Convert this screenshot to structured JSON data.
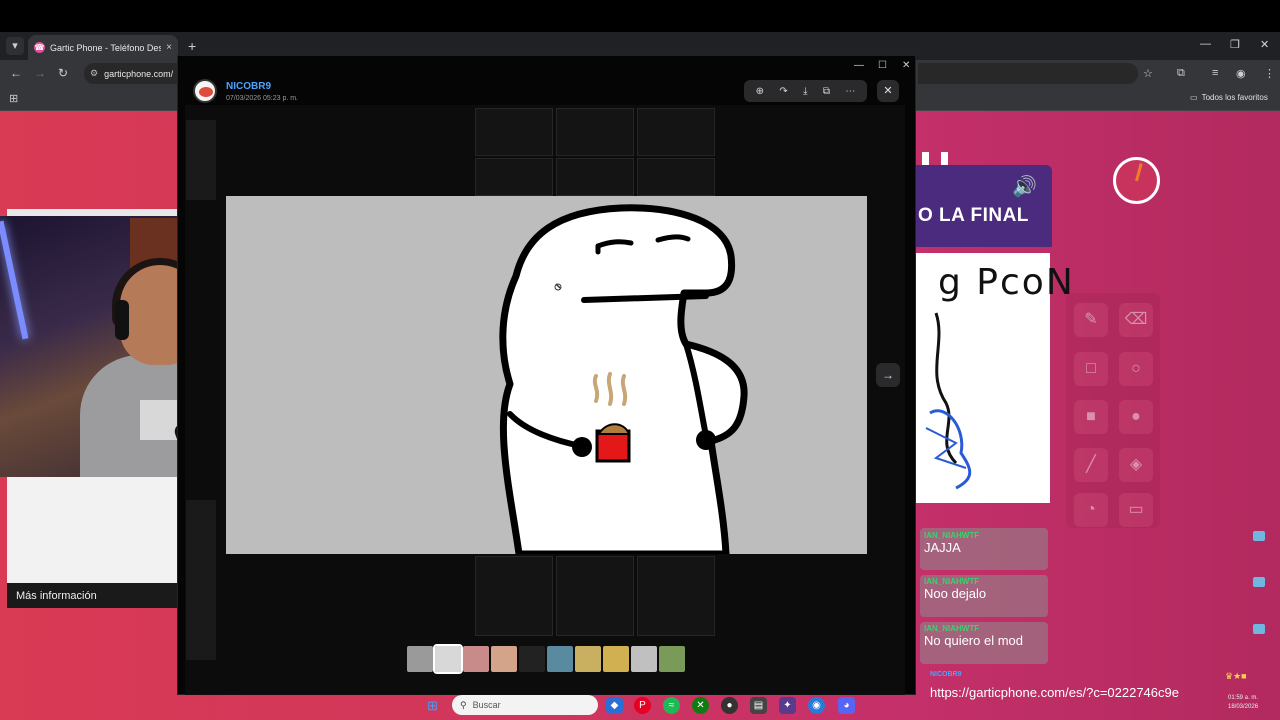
{
  "browser": {
    "tab_title": "Gartic Phone - Teléfono Descon",
    "tab_close": "×",
    "new_tab": "+",
    "url": "garticphone.com/",
    "bookmarks_folder": "Todos los favoritos",
    "window_controls": [
      "—",
      "❐",
      "✕"
    ]
  },
  "viewer": {
    "username": "NICOBR9",
    "timestamp": "07/03/2026 05:23 p. m.",
    "toolbar_icons": [
      "zoom-icon",
      "share-icon",
      "download-icon",
      "open-external-icon",
      "more-icon"
    ],
    "toolbar_glyphs": [
      "⊕",
      "↷",
      "⤓",
      "⧉",
      "⋯"
    ],
    "close_glyph": "✕",
    "next_glyph": "→",
    "window_controls": [
      "—",
      "☐",
      "✕"
    ]
  },
  "game": {
    "header_text": "O LA FINAL",
    "drawing_caption": "g PcoN",
    "tools": [
      "✎",
      "⌫",
      "□",
      "○",
      "■",
      "●",
      "╱",
      "◈",
      "◔",
      "▭"
    ]
  },
  "chat": {
    "messages": [
      {
        "user": "IAN_NIAHWTF",
        "text": "JAJJA"
      },
      {
        "user": "IAN_NIAHWTF",
        "text": "Noo dejalo"
      },
      {
        "user": "IAN_NIAHWTF",
        "text": "No quiero el mod"
      }
    ],
    "last_user": "NICOBR9",
    "last_text": "https://garticphone.com/es/?c=0222746c9e"
  },
  "webcam_overlay": {
    "more_info": "Más información"
  },
  "taskbar": {
    "search_placeholder": "Buscar",
    "clock_time": "01:59 a. m.",
    "clock_date": "18/03/2026"
  },
  "colors": {
    "page_bg": "#d0365c",
    "game_header": "#4a2b7e",
    "username_blue": "#4da3ff",
    "chat_name_green": "#38d46a"
  }
}
